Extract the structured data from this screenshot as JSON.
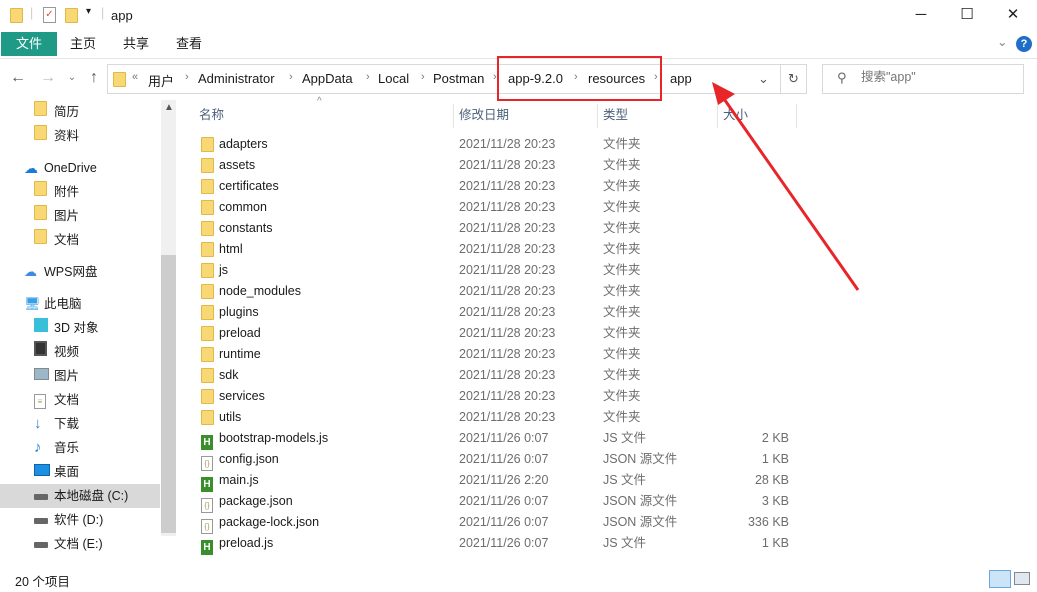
{
  "window": {
    "title": "app",
    "minimize": "─",
    "maximize": "☐",
    "close": "✕"
  },
  "ribbon": {
    "tabs": [
      "文件",
      "主页",
      "共享",
      "查看"
    ],
    "help": "?",
    "expand": "⌄"
  },
  "address": {
    "crumbs": [
      "用户",
      "Administrator",
      "AppData",
      "Local",
      "Postman",
      "app-9.2.0",
      "resources",
      "app"
    ],
    "overflow": "«",
    "dropdown": "⌄",
    "refresh": "↻"
  },
  "search": {
    "placeholder": "搜索\"app\""
  },
  "nav_items": [
    {
      "label": "简历",
      "icon": "folder-icon",
      "indent": 1
    },
    {
      "label": "资料",
      "icon": "folder-icon",
      "indent": 1
    },
    {
      "label": "OneDrive",
      "icon": "cloud-icon",
      "indent": 0
    },
    {
      "label": "附件",
      "icon": "folder-icon",
      "indent": 1
    },
    {
      "label": "图片",
      "icon": "folder-icon",
      "indent": 1
    },
    {
      "label": "文档",
      "icon": "folder-icon",
      "indent": 1
    },
    {
      "label": "WPS网盘",
      "icon": "wps-cloud-icon",
      "indent": 0
    },
    {
      "label": "此电脑",
      "icon": "computer-icon",
      "indent": 0
    },
    {
      "label": "3D 对象",
      "icon": "cube-icon",
      "indent": 1
    },
    {
      "label": "视频",
      "icon": "video-icon",
      "indent": 1
    },
    {
      "label": "图片",
      "icon": "picture-icon",
      "indent": 1
    },
    {
      "label": "文档",
      "icon": "document-icon",
      "indent": 1
    },
    {
      "label": "下载",
      "icon": "download-icon",
      "indent": 1
    },
    {
      "label": "音乐",
      "icon": "music-icon",
      "indent": 1
    },
    {
      "label": "桌面",
      "icon": "desktop-icon",
      "indent": 1
    },
    {
      "label": "本地磁盘 (C:)",
      "icon": "drive-icon",
      "indent": 1,
      "selected": true
    },
    {
      "label": "软件 (D:)",
      "icon": "drive-icon",
      "indent": 1
    },
    {
      "label": "文档 (E:)",
      "icon": "drive-icon",
      "indent": 1
    }
  ],
  "columns": {
    "name": "名称",
    "date": "修改日期",
    "type": "类型",
    "size": "大小"
  },
  "files": [
    {
      "name": "adapters",
      "date": "2021/11/28 20:23",
      "type": "文件夹",
      "size": "",
      "kind": "folder"
    },
    {
      "name": "assets",
      "date": "2021/11/28 20:23",
      "type": "文件夹",
      "size": "",
      "kind": "folder"
    },
    {
      "name": "certificates",
      "date": "2021/11/28 20:23",
      "type": "文件夹",
      "size": "",
      "kind": "folder"
    },
    {
      "name": "common",
      "date": "2021/11/28 20:23",
      "type": "文件夹",
      "size": "",
      "kind": "folder"
    },
    {
      "name": "constants",
      "date": "2021/11/28 20:23",
      "type": "文件夹",
      "size": "",
      "kind": "folder"
    },
    {
      "name": "html",
      "date": "2021/11/28 20:23",
      "type": "文件夹",
      "size": "",
      "kind": "folder"
    },
    {
      "name": "js",
      "date": "2021/11/28 20:23",
      "type": "文件夹",
      "size": "",
      "kind": "folder"
    },
    {
      "name": "node_modules",
      "date": "2021/11/28 20:23",
      "type": "文件夹",
      "size": "",
      "kind": "folder"
    },
    {
      "name": "plugins",
      "date": "2021/11/28 20:23",
      "type": "文件夹",
      "size": "",
      "kind": "folder"
    },
    {
      "name": "preload",
      "date": "2021/11/28 20:23",
      "type": "文件夹",
      "size": "",
      "kind": "folder"
    },
    {
      "name": "runtime",
      "date": "2021/11/28 20:23",
      "type": "文件夹",
      "size": "",
      "kind": "folder"
    },
    {
      "name": "sdk",
      "date": "2021/11/28 20:23",
      "type": "文件夹",
      "size": "",
      "kind": "folder"
    },
    {
      "name": "services",
      "date": "2021/11/28 20:23",
      "type": "文件夹",
      "size": "",
      "kind": "folder"
    },
    {
      "name": "utils",
      "date": "2021/11/28 20:23",
      "type": "文件夹",
      "size": "",
      "kind": "folder"
    },
    {
      "name": "bootstrap-models.js",
      "date": "2021/11/26 0:07",
      "type": "JS 文件",
      "size": "2 KB",
      "kind": "js"
    },
    {
      "name": "config.json",
      "date": "2021/11/26 0:07",
      "type": "JSON 源文件",
      "size": "1 KB",
      "kind": "json"
    },
    {
      "name": "main.js",
      "date": "2021/11/26 2:20",
      "type": "JS 文件",
      "size": "28 KB",
      "kind": "js"
    },
    {
      "name": "package.json",
      "date": "2021/11/26 0:07",
      "type": "JSON 源文件",
      "size": "3 KB",
      "kind": "json"
    },
    {
      "name": "package-lock.json",
      "date": "2021/11/26 0:07",
      "type": "JSON 源文件",
      "size": "336 KB",
      "kind": "json"
    },
    {
      "name": "preload.js",
      "date": "2021/11/26 0:07",
      "type": "JS 文件",
      "size": "1 KB",
      "kind": "js"
    }
  ],
  "status": {
    "count": "20 个项目"
  },
  "colors": {
    "file_tab": "#1e9a87",
    "annotation": "#e8262a",
    "selected": "#d9d9d9"
  }
}
